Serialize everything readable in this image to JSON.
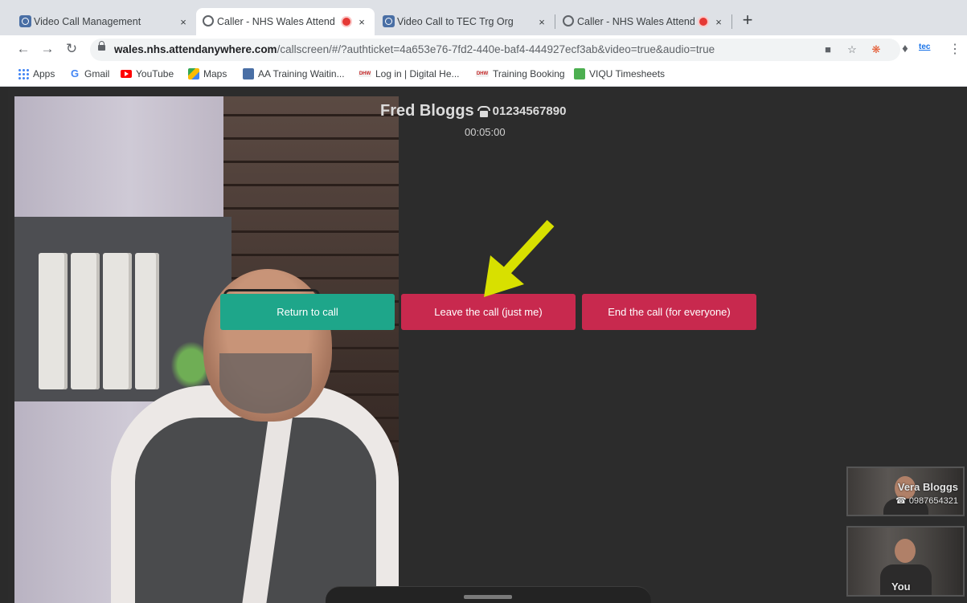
{
  "browser": {
    "tabs": [
      {
        "title": "Video Call Management",
        "icon": "video-call-favicon",
        "active": false,
        "recording": false
      },
      {
        "title": "Caller - NHS Wales Attend",
        "icon": "globe-favicon",
        "active": true,
        "recording": true
      },
      {
        "title": "Video Call to TEC Trg Org",
        "icon": "video-call-favicon",
        "active": false,
        "recording": false
      },
      {
        "title": "Caller - NHS Wales Attend",
        "icon": "globe-favicon",
        "active": false,
        "recording": true
      }
    ],
    "close_glyph": "×",
    "new_tab_glyph": "+",
    "url_host": "wales.nhs.attendanywhere.com",
    "url_path": "/callscreen/#/?authticket=4a653e76-7fd2-440e-baf4-444927ecf3ab&video=true&audio=true",
    "extension_label": "tec",
    "bookmarks": [
      {
        "label": "Apps",
        "icon": "apps-grid-icon"
      },
      {
        "label": "Gmail",
        "icon": "google-icon",
        "glyph": "G"
      },
      {
        "label": "YouTube",
        "icon": "youtube-icon"
      },
      {
        "label": "Maps",
        "icon": "maps-icon"
      },
      {
        "label": "AA Training Waitin...",
        "icon": "video-call-icon"
      },
      {
        "label": "Log in | Digital He...",
        "icon": "dhw-icon",
        "glyph": "DHW"
      },
      {
        "label": "Training Booking",
        "icon": "dhw-icon",
        "glyph": "DHW"
      },
      {
        "label": "VIQU Timesheets",
        "icon": "viqu-icon"
      }
    ]
  },
  "call": {
    "caller_name": "Fred Bloggs",
    "caller_number": "01234567890",
    "duration": "00:05:00",
    "buttons": {
      "return": "Return to call",
      "leave": "Leave the call (just me)",
      "end": "End the call (for everyone)"
    },
    "participants": [
      {
        "name": "Vera Bloggs",
        "number": "0987654321"
      },
      {
        "name": "You"
      }
    ]
  },
  "colors": {
    "return_button": "#1ea68a",
    "leave_button": "#c8294e",
    "end_button": "#c8294e",
    "arrow": "#d8e000"
  }
}
